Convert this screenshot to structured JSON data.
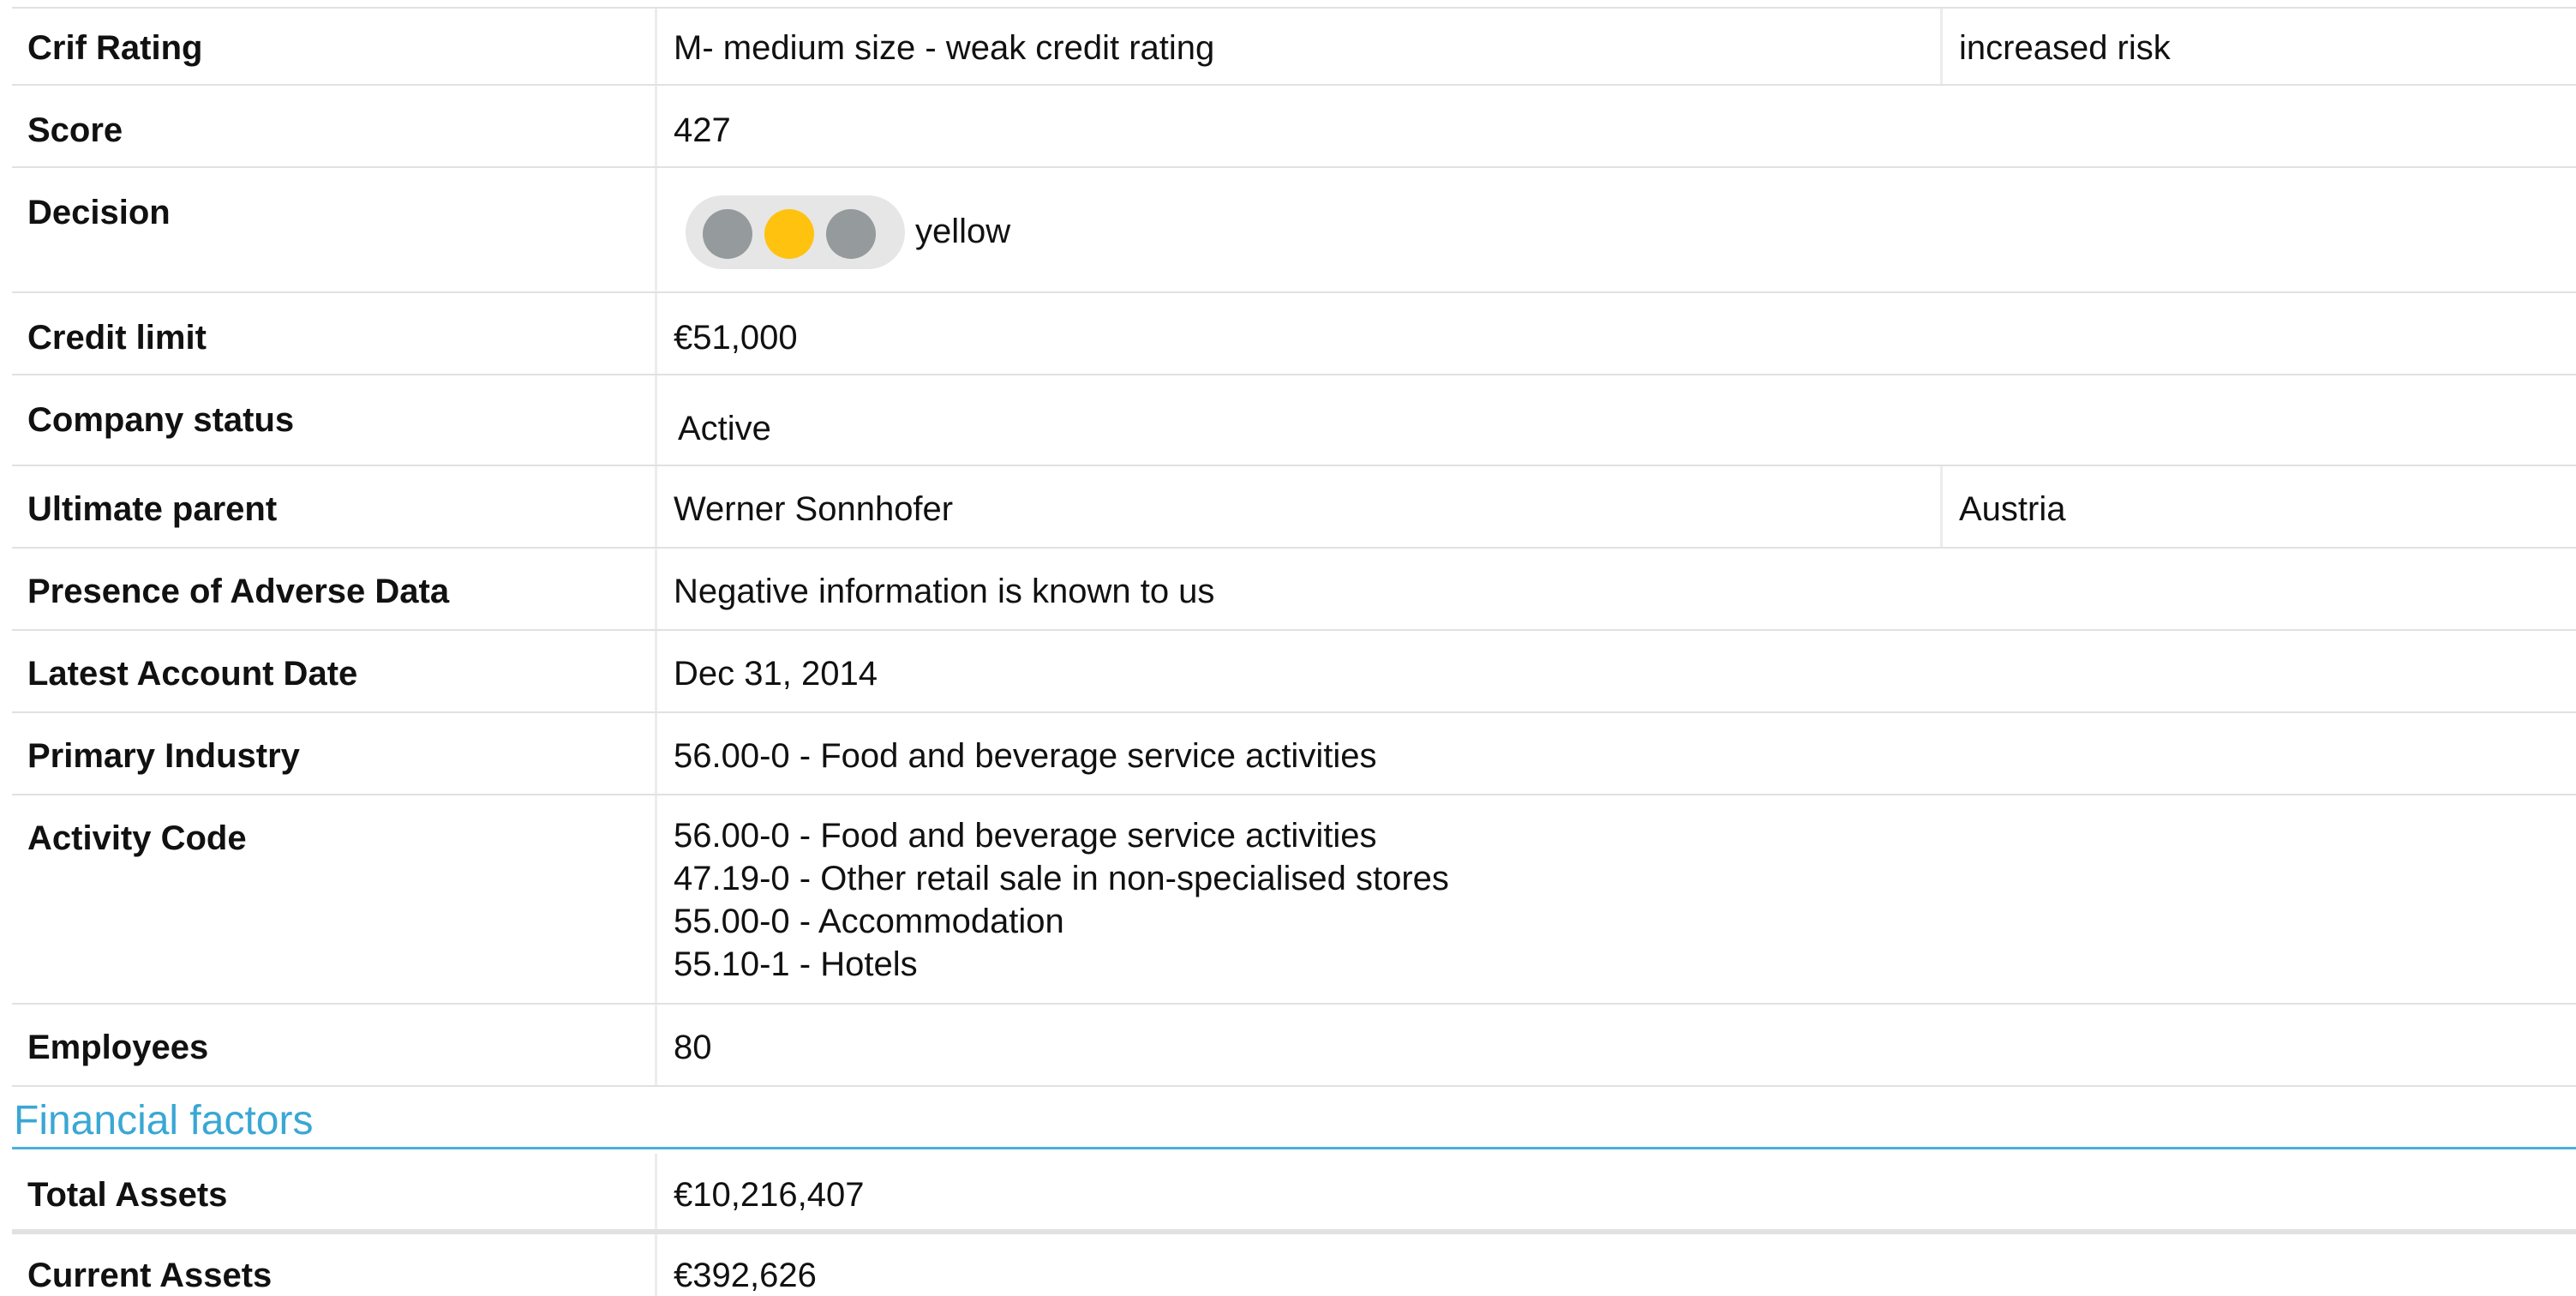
{
  "rows": {
    "crif_rating": {
      "label": "Crif Rating",
      "value": "M- medium size - weak credit rating",
      "extra": "increased risk"
    },
    "score": {
      "label": "Score",
      "value": "427"
    },
    "decision": {
      "label": "Decision",
      "value": "yellow"
    },
    "credit_limit": {
      "label": "Credit limit",
      "value": "€51,000"
    },
    "company_status": {
      "label": "Company status",
      "value": "Active"
    },
    "ultimate_parent": {
      "label": "Ultimate parent",
      "value": "Werner Sonnhofer",
      "extra": "Austria"
    },
    "adverse_data": {
      "label": "Presence of Adverse Data",
      "value": "Negative information is known to us"
    },
    "latest_account_date": {
      "label": "Latest Account Date",
      "value": "Dec 31, 2014"
    },
    "primary_industry": {
      "label": "Primary Industry",
      "value": "56.00-0 - Food and beverage service activities"
    },
    "activity_code": {
      "label": "Activity Code",
      "values": [
        "56.00-0 - Food and beverage service activities",
        "47.19-0 - Other retail sale in non-specialised stores",
        "55.00-0 - Accommodation",
        "55.10-1 - Hotels"
      ]
    },
    "employees": {
      "label": "Employees",
      "value": "80"
    }
  },
  "financial": {
    "title": "Financial factors",
    "total_assets": {
      "label": "Total Assets",
      "value": "€10,216,407"
    },
    "current_assets": {
      "label": "Current Assets",
      "value": "€392,626"
    }
  },
  "traffic_light": {
    "lights": [
      "off-icon",
      "yellow-light-icon",
      "off-icon"
    ],
    "active_color": "#ffc20e",
    "inactive_color": "#959a9c"
  },
  "colors": {
    "section_title": "#3aa7d4",
    "divider": "#e1e1e1"
  }
}
